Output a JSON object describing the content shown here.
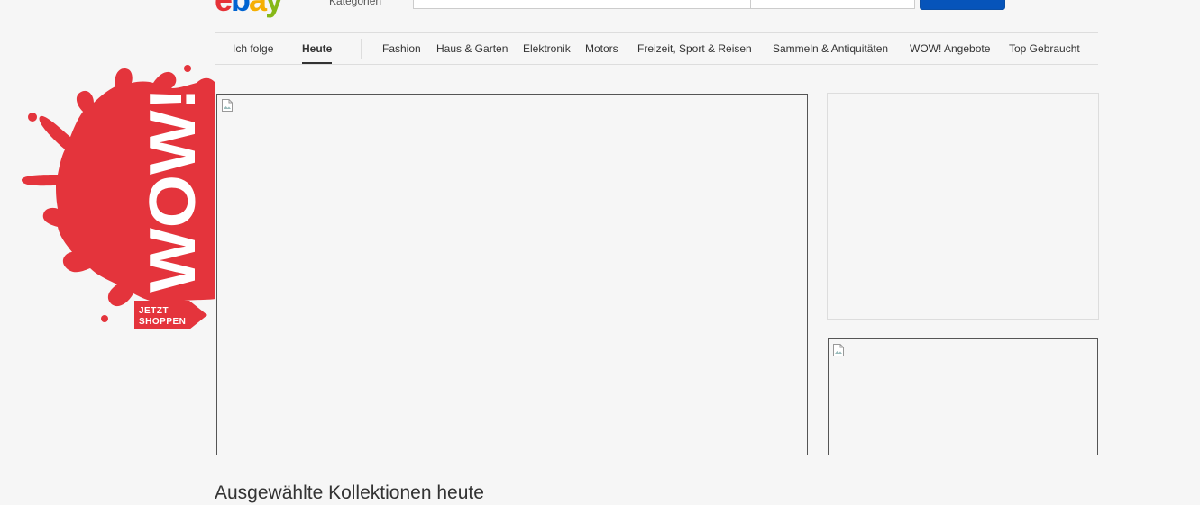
{
  "header": {
    "logo": {
      "l1": "e",
      "l2": "b",
      "l3": "a",
      "l4": "y"
    },
    "categories_label": "Kategorien",
    "search": {
      "placeholder": ""
    },
    "colors": {
      "logo_red": "#e53238",
      "logo_blue": "#0064d2",
      "logo_yellow": "#f5af02",
      "logo_green": "#86b817",
      "search_button": "#0654ba"
    }
  },
  "nav": {
    "items": [
      {
        "label": "Ich folge"
      },
      {
        "label": "Heute",
        "active": true
      },
      {
        "label": "Fashion"
      },
      {
        "label": "Haus & Garten"
      },
      {
        "label": "Elektronik"
      },
      {
        "label": "Motors"
      },
      {
        "label": "Freizeit, Sport & Reisen"
      },
      {
        "label": "Sammeln & Antiquitäten"
      },
      {
        "label": "WOW! Angebote"
      },
      {
        "label": "Top Gebraucht"
      }
    ]
  },
  "wow_badge": {
    "title": "WOW!",
    "cta_line1": "JETZT",
    "cta_line2": "SHOPPEN",
    "color": "#e4343c"
  },
  "banners": {
    "main_icon": "broken-image-icon",
    "side_bottom_icon": "broken-image-icon"
  },
  "section": {
    "heading": "Ausgewählte Kollektionen heute"
  }
}
